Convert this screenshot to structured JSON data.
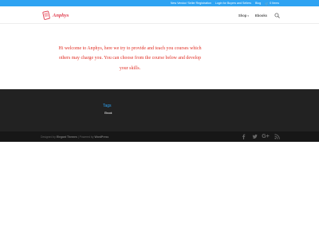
{
  "top_bar": {
    "links": [
      "New Vendor/ Seller Registration",
      "Login for Buyers and Sellers",
      "Blog"
    ],
    "cart_label": "0 Items"
  },
  "header": {
    "logo_text": "Anphys",
    "nav": [
      "Shop",
      "Ebooks"
    ],
    "search_icon": "search-icon"
  },
  "main": {
    "welcome_lines": [
      "Hi welcome to Anphys, here we try to provide and teach you courses which",
      "others may charge you. You can choose from the course below and develop",
      "your skills."
    ]
  },
  "footer": {
    "tags_title": "Tags",
    "tags": [
      "Ebook"
    ],
    "credits": {
      "designed_by": "Designed by",
      "theme_name": "Elegant Themes",
      "separator": " | Powered by ",
      "platform": "WordPress"
    },
    "social_icons": [
      "facebook-icon",
      "twitter-icon",
      "google-plus-icon",
      "rss-icon"
    ]
  },
  "colors": {
    "accent": "#2ea3f2",
    "welcome_text": "#e02b20",
    "logo": "#e03c4d",
    "footer_bg": "#222222",
    "bottom_bar_bg": "#171717"
  }
}
